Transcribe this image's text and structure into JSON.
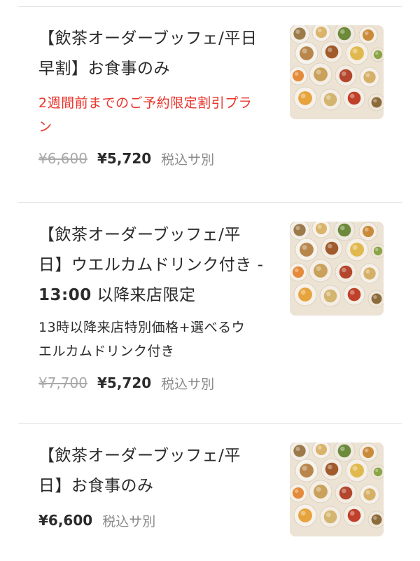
{
  "plans": [
    {
      "title_line1": "【飲茶オーダーブッフェ/平日",
      "title_line2": "早割】お食事のみ",
      "description_lines": [
        "2週間前までのご予約限定割引プラ",
        "ン"
      ],
      "description_color": "#e8332a",
      "original_price": "¥6,600",
      "price": "¥5,720",
      "tax_note": "税込サ別",
      "image_icon": "dim-sum-photo-icon"
    },
    {
      "title_line1": "【飲茶オーダーブッフェ/平",
      "title_line2": "日】ウエルカムドリンク付き -",
      "title_line3_bold": "13:00",
      "title_line3_rest": " 以降来店限定",
      "description_lines": [
        "13時以降来店特別価格+選べるウ",
        "エルカムドリンク付き"
      ],
      "description_color": "#2b2b2b",
      "original_price": "¥7,700",
      "price": "¥5,720",
      "tax_note": "税込サ別",
      "image_icon": "dim-sum-photo-icon"
    },
    {
      "title_line1": "【飲茶オーダーブッフェ/平",
      "title_line2": "日】お食事のみ",
      "price": "¥6,600",
      "tax_note": "税込サ別",
      "image_icon": "dim-sum-photo-icon"
    }
  ]
}
